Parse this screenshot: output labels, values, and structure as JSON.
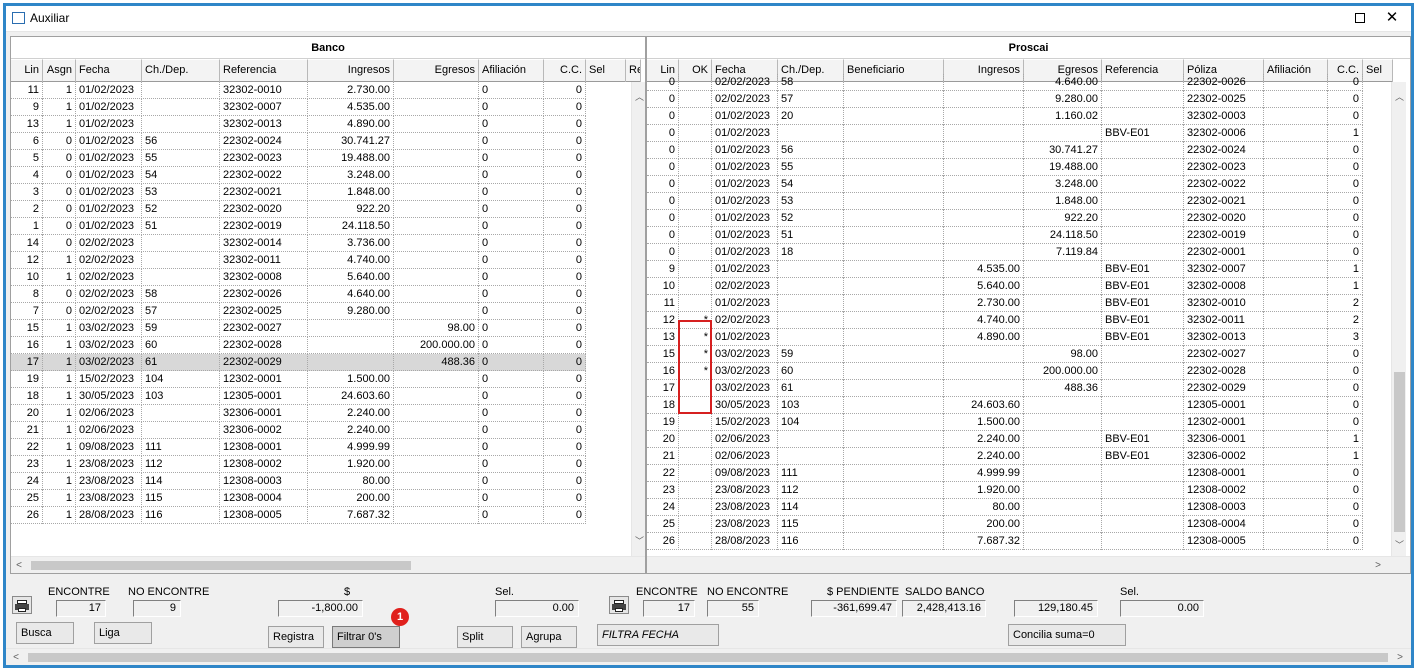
{
  "window": {
    "title": "Auxiliar"
  },
  "banco": {
    "title": "Banco",
    "columns": [
      "Lin",
      "Asgn",
      "Fecha",
      "Ch./Dep.",
      "Referencia",
      "Ingresos",
      "Egresos",
      "Afiliación",
      "C.C.",
      "Sel",
      "Re"
    ],
    "rows": [
      [
        "11",
        "1",
        "01/02/2023",
        "",
        "32302-0010",
        "2.730.00",
        "",
        "0",
        "0"
      ],
      [
        "9",
        "1",
        "01/02/2023",
        "",
        "32302-0007",
        "4.535.00",
        "",
        "0",
        "0"
      ],
      [
        "13",
        "1",
        "01/02/2023",
        "",
        "32302-0013",
        "4.890.00",
        "",
        "0",
        "0"
      ],
      [
        "6",
        "0",
        "01/02/2023",
        "56",
        "22302-0024",
        "30.741.27",
        "",
        "0",
        "0"
      ],
      [
        "5",
        "0",
        "01/02/2023",
        "55",
        "22302-0023",
        "19.488.00",
        "",
        "0",
        "0"
      ],
      [
        "4",
        "0",
        "01/02/2023",
        "54",
        "22302-0022",
        "3.248.00",
        "",
        "0",
        "0"
      ],
      [
        "3",
        "0",
        "01/02/2023",
        "53",
        "22302-0021",
        "1.848.00",
        "",
        "0",
        "0"
      ],
      [
        "2",
        "0",
        "01/02/2023",
        "52",
        "22302-0020",
        "922.20",
        "",
        "0",
        "0"
      ],
      [
        "1",
        "0",
        "01/02/2023",
        "51",
        "22302-0019",
        "24.118.50",
        "",
        "0",
        "0"
      ],
      [
        "14",
        "0",
        "02/02/2023",
        "",
        "32302-0014",
        "3.736.00",
        "",
        "0",
        "0"
      ],
      [
        "12",
        "1",
        "02/02/2023",
        "",
        "32302-0011",
        "4.740.00",
        "",
        "0",
        "0"
      ],
      [
        "10",
        "1",
        "02/02/2023",
        "",
        "32302-0008",
        "5.640.00",
        "",
        "0",
        "0"
      ],
      [
        "8",
        "0",
        "02/02/2023",
        "58",
        "22302-0026",
        "4.640.00",
        "",
        "0",
        "0"
      ],
      [
        "7",
        "0",
        "02/02/2023",
        "57",
        "22302-0025",
        "9.280.00",
        "",
        "0",
        "0"
      ],
      [
        "15",
        "1",
        "03/02/2023",
        "59",
        "22302-0027",
        "",
        "98.00",
        "0",
        "0"
      ],
      [
        "16",
        "1",
        "03/02/2023",
        "60",
        "22302-0028",
        "",
        "200.000.00",
        "0",
        "0"
      ],
      [
        "17",
        "1",
        "03/02/2023",
        "61",
        "22302-0029",
        "",
        "488.36",
        "0",
        "0"
      ],
      [
        "19",
        "1",
        "15/02/2023",
        "104",
        "12302-0001",
        "1.500.00",
        "",
        "0",
        "0"
      ],
      [
        "18",
        "1",
        "30/05/2023",
        "103",
        "12305-0001",
        "24.603.60",
        "",
        "0",
        "0"
      ],
      [
        "20",
        "1",
        "02/06/2023",
        "",
        "32306-0001",
        "2.240.00",
        "",
        "0",
        "0"
      ],
      [
        "21",
        "1",
        "02/06/2023",
        "",
        "32306-0002",
        "2.240.00",
        "",
        "0",
        "0"
      ],
      [
        "22",
        "1",
        "09/08/2023",
        "111",
        "12308-0001",
        "4.999.99",
        "",
        "0",
        "0"
      ],
      [
        "23",
        "1",
        "23/08/2023",
        "112",
        "12308-0002",
        "1.920.00",
        "",
        "0",
        "0"
      ],
      [
        "24",
        "1",
        "23/08/2023",
        "114",
        "12308-0003",
        "80.00",
        "",
        "0",
        "0"
      ],
      [
        "25",
        "1",
        "23/08/2023",
        "115",
        "12308-0004",
        "200.00",
        "",
        "0",
        "0"
      ],
      [
        "26",
        "1",
        "28/08/2023",
        "116",
        "12308-0005",
        "7.687.32",
        "",
        "0",
        "0"
      ]
    ],
    "selected_row": 16
  },
  "proscai": {
    "title": "Proscai",
    "columns": [
      "Lin",
      "OK",
      "Fecha",
      "Ch./Dep.",
      "Beneficiario",
      "Ingresos",
      "Egresos",
      "Referencia",
      "Póliza",
      "Afiliación",
      "C.C.",
      "Sel"
    ],
    "partial_row": [
      "0",
      "",
      "02/02/2023",
      "58",
      "",
      "",
      "4.640.00",
      "",
      "22302-0026",
      "",
      "0"
    ],
    "rows": [
      [
        "0",
        "",
        "02/02/2023",
        "57",
        "",
        "",
        "9.280.00",
        "",
        "22302-0025",
        "",
        "0"
      ],
      [
        "0",
        "",
        "01/02/2023",
        "20",
        "",
        "",
        "1.160.02",
        "",
        "32302-0003",
        "",
        "0"
      ],
      [
        "0",
        "",
        "01/02/2023",
        "",
        "",
        "",
        "",
        "BBV-E01",
        "32302-0006",
        "",
        "1"
      ],
      [
        "0",
        "",
        "01/02/2023",
        "56",
        "",
        "",
        "30.741.27",
        "",
        "22302-0024",
        "",
        "0"
      ],
      [
        "0",
        "",
        "01/02/2023",
        "55",
        "",
        "",
        "19.488.00",
        "",
        "22302-0023",
        "",
        "0"
      ],
      [
        "0",
        "",
        "01/02/2023",
        "54",
        "",
        "",
        "3.248.00",
        "",
        "22302-0022",
        "",
        "0"
      ],
      [
        "0",
        "",
        "01/02/2023",
        "53",
        "",
        "",
        "1.848.00",
        "",
        "22302-0021",
        "",
        "0"
      ],
      [
        "0",
        "",
        "01/02/2023",
        "52",
        "",
        "",
        "922.20",
        "",
        "22302-0020",
        "",
        "0"
      ],
      [
        "0",
        "",
        "01/02/2023",
        "51",
        "",
        "",
        "24.118.50",
        "",
        "22302-0019",
        "",
        "0"
      ],
      [
        "0",
        "",
        "01/02/2023",
        "18",
        "",
        "",
        "7.119.84",
        "",
        "22302-0001",
        "",
        "0"
      ],
      [
        "9",
        "",
        "01/02/2023",
        "",
        "",
        "4.535.00",
        "",
        "BBV-E01",
        "32302-0007",
        "",
        "1"
      ],
      [
        "10",
        "",
        "02/02/2023",
        "",
        "",
        "5.640.00",
        "",
        "BBV-E01",
        "32302-0008",
        "",
        "1"
      ],
      [
        "11",
        "",
        "01/02/2023",
        "",
        "",
        "2.730.00",
        "",
        "BBV-E01",
        "32302-0010",
        "",
        "2"
      ],
      [
        "12",
        "*",
        "02/02/2023",
        "",
        "",
        "4.740.00",
        "",
        "BBV-E01",
        "32302-0011",
        "",
        "2"
      ],
      [
        "13",
        "*",
        "01/02/2023",
        "",
        "",
        "4.890.00",
        "",
        "BBV-E01",
        "32302-0013",
        "",
        "3"
      ],
      [
        "15",
        "*",
        "03/02/2023",
        "59",
        "",
        "",
        "98.00",
        "",
        "22302-0027",
        "",
        "0"
      ],
      [
        "16",
        "*",
        "03/02/2023",
        "60",
        "",
        "",
        "200.000.00",
        "",
        "22302-0028",
        "",
        "0"
      ],
      [
        "17",
        "",
        "03/02/2023",
        "61",
        "",
        "",
        "488.36",
        "",
        "22302-0029",
        "",
        "0"
      ],
      [
        "18",
        "",
        "30/05/2023",
        "103",
        "",
        "24.603.60",
        "",
        "",
        "12305-0001",
        "",
        "0"
      ],
      [
        "19",
        "",
        "15/02/2023",
        "104",
        "",
        "1.500.00",
        "",
        "",
        "12302-0001",
        "",
        "0"
      ],
      [
        "20",
        "",
        "02/06/2023",
        "",
        "",
        "2.240.00",
        "",
        "BBV-E01",
        "32306-0001",
        "",
        "1"
      ],
      [
        "21",
        "",
        "02/06/2023",
        "",
        "",
        "2.240.00",
        "",
        "BBV-E01",
        "32306-0002",
        "",
        "1"
      ],
      [
        "22",
        "",
        "09/08/2023",
        "111",
        "",
        "4.999.99",
        "",
        "",
        "12308-0001",
        "",
        "0"
      ],
      [
        "23",
        "",
        "23/08/2023",
        "112",
        "",
        "1.920.00",
        "",
        "",
        "12308-0002",
        "",
        "0"
      ],
      [
        "24",
        "",
        "23/08/2023",
        "114",
        "",
        "80.00",
        "",
        "",
        "12308-0003",
        "",
        "0"
      ],
      [
        "25",
        "",
        "23/08/2023",
        "115",
        "",
        "200.00",
        "",
        "",
        "12308-0004",
        "",
        "0"
      ],
      [
        "26",
        "",
        "28/08/2023",
        "116",
        "",
        "7.687.32",
        "",
        "",
        "12308-0005",
        "",
        "0"
      ]
    ]
  },
  "footer_left": {
    "encontre_label": "ENCONTRE",
    "encontre_value": "17",
    "no_encontre_label": "NO ENCONTRE",
    "no_encontre_value": "9",
    "dollar_label": "$",
    "dollar_value": "-1,800.00",
    "sel_label": "Sel.",
    "sel_value": "0.00"
  },
  "footer_right": {
    "encontre_label": "ENCONTRE",
    "encontre_value": "17",
    "no_encontre_label": "NO ENCONTRE",
    "no_encontre_value": "55",
    "pendiente_label": "$ PENDIENTE",
    "pendiente_value": "-361,699.47",
    "saldo_label": "SALDO BANCO",
    "saldo_value": "2,428,413.16",
    "extra_value": "129,180.45",
    "sel_label": "Sel.",
    "sel_value": "0.00"
  },
  "buttons": {
    "busca": "Busca",
    "liga": "Liga",
    "registra": "Registra",
    "filtrar": "Filtrar  0's",
    "split": "Split",
    "agrupa": "Agrupa",
    "filtra_fecha": "FILTRA FECHA",
    "concilia": "Concilia suma=0"
  },
  "annotation": {
    "badge": "1"
  },
  "colors": {
    "window_border": "#2f86c8",
    "badge": "#e0201c",
    "highlight_box": "#d62020"
  }
}
